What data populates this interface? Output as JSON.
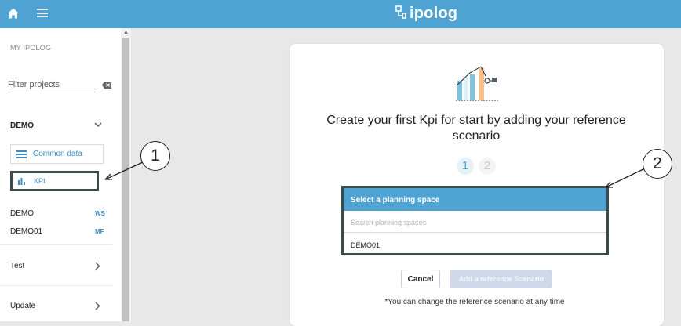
{
  "header": {
    "brand": "ipolog",
    "home_icon": "home-icon",
    "menu_icon": "hamburger-menu-icon",
    "color": "#4ea3d3"
  },
  "sidebar": {
    "section_title": "MY IPOLOG",
    "filter_placeholder": "Filter projects",
    "project": "DEMO",
    "nav": [
      {
        "label": "Common data",
        "icon": "list-icon"
      },
      {
        "label": "KPI",
        "icon": "bar-chart-icon"
      }
    ],
    "workspaces": [
      {
        "name": "DEMO",
        "tag": "WS"
      },
      {
        "name": "DEMO01",
        "tag": "MF"
      }
    ],
    "groups": [
      {
        "label": "Test"
      },
      {
        "label": "Update"
      }
    ]
  },
  "main": {
    "heading": "Create your first Kpi for start by adding your reference scenario",
    "steps": [
      "1",
      "2"
    ],
    "active_step": 1,
    "planning": {
      "header": "Select a planning space",
      "search_placeholder": "Search planning spaces",
      "options": [
        "DEMO01"
      ]
    },
    "cancel_label": "Cancel",
    "add_label": "Add a reference Scenario",
    "note": "*You can change the reference scenario at any time"
  },
  "callouts": [
    "1",
    "2"
  ]
}
